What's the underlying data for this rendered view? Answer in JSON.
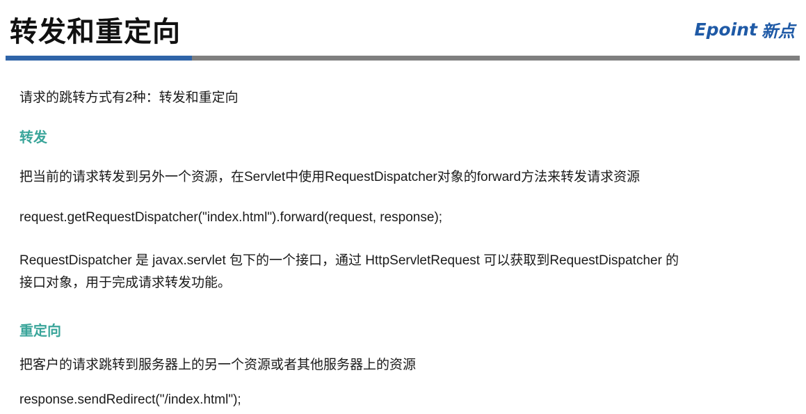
{
  "header": {
    "title": "转发和重定向",
    "logo_latin": "Epoint",
    "logo_cjk": "新点"
  },
  "colors": {
    "accent_blue": "#2f64a8",
    "bar_gray": "#7f7f7f",
    "heading_teal": "#3aa59a",
    "logo_blue": "#1f5aa6"
  },
  "content": {
    "intro": "请求的跳转方式有2种：转发和重定向",
    "forward": {
      "heading": "转发",
      "description": "把当前的请求转发到另外一个资源，在Servlet中使用RequestDispatcher对象的forward方法来转发请求资源",
      "code": "request.getRequestDispatcher(\"index.html\").forward(request, response);",
      "note_line1": "RequestDispatcher 是 javax.servlet 包下的一个接口，通过 HttpServletRequest 可以获取到RequestDispatcher 的",
      "note_line2": "接口对象，用于完成请求转发功能。"
    },
    "redirect": {
      "heading": "重定向",
      "description": "把客户的请求跳转到服务器上的另一个资源或者其他服务器上的资源",
      "code": "response.sendRedirect(\"/index.html\");"
    }
  }
}
